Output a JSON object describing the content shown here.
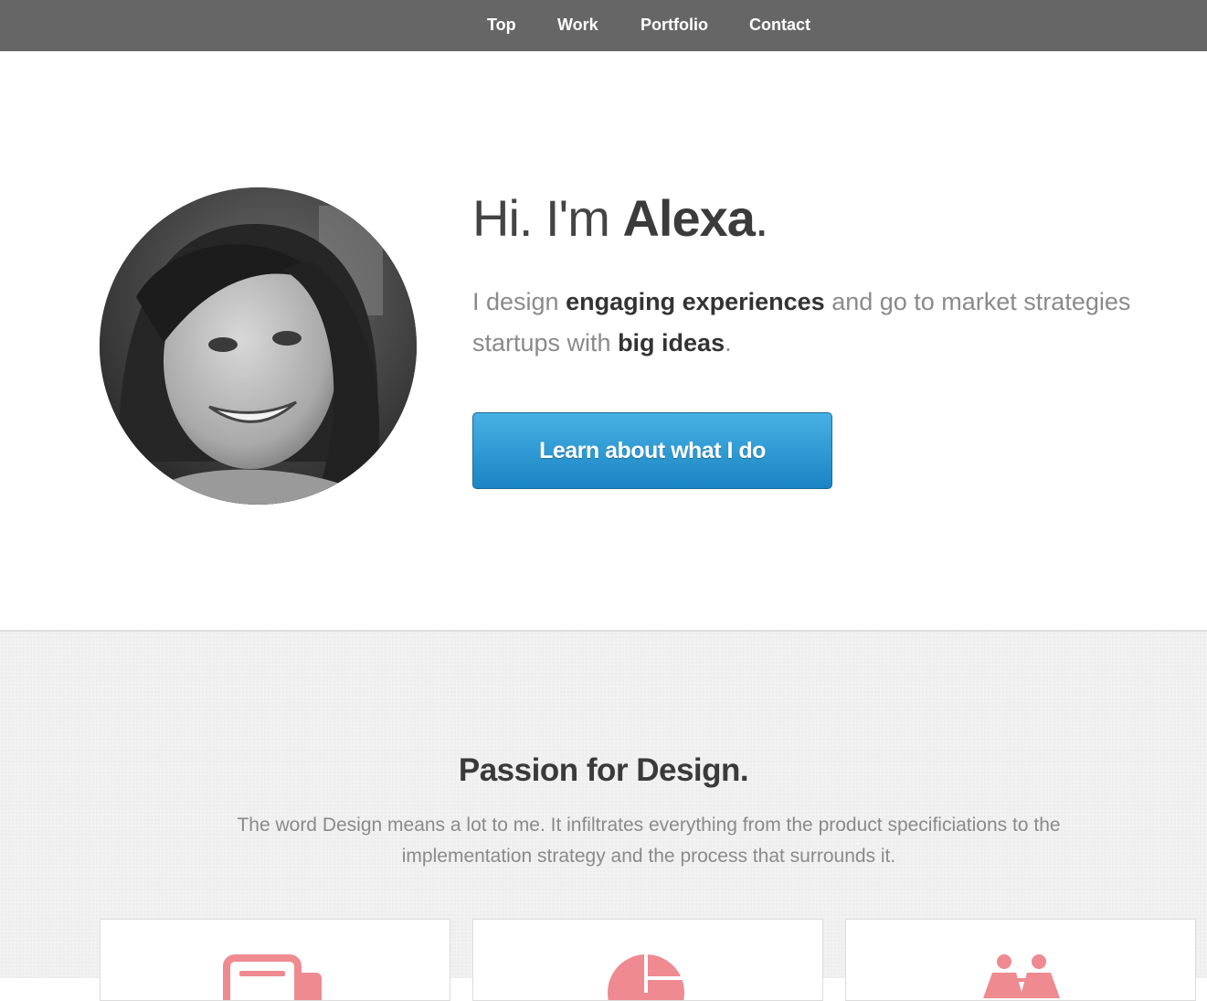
{
  "nav": {
    "items": [
      "Top",
      "Work",
      "Portfolio",
      "Contact"
    ]
  },
  "hero": {
    "greeting_prefix": "Hi. I'm ",
    "greeting_name": "Alexa",
    "greeting_suffix": ".",
    "intro": {
      "t1": "I design ",
      "b1": "engaging experiences",
      "t2": " and go to market strategies startups with ",
      "b2": "big ideas",
      "t3": "."
    },
    "cta_label": "Learn about what I do",
    "cta_color": "#2a9ad6"
  },
  "passion": {
    "title": "Passion for Design.",
    "text": "The word Design means a lot to me. It infiltrates everything from the product specificiations to the implementation strategy and the process that surrounds it."
  },
  "cards": [
    {
      "icon": "document-icon"
    },
    {
      "icon": "pie-chart-icon"
    },
    {
      "icon": "people-icon"
    }
  ],
  "colors": {
    "nav_bg": "#666666",
    "accent_icon": "#ee8a90",
    "section_bg": "#f1f1f1"
  }
}
